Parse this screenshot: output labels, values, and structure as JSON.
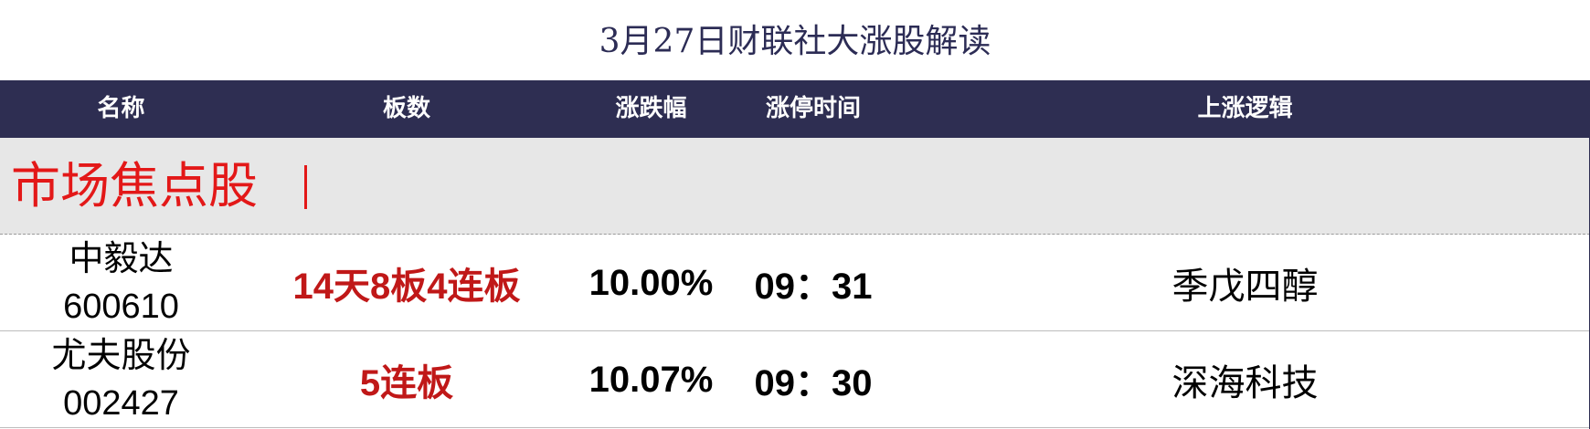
{
  "title": "3月27日财联社大涨股解读",
  "header": {
    "name": "名称",
    "boards": "板数",
    "change": "涨跌幅",
    "limit_time": "涨停时间",
    "logic": "上涨逻辑"
  },
  "section": {
    "label": "市场焦点股"
  },
  "rows": [
    {
      "name": "中毅达",
      "code": "600610",
      "boards": "14天8板4连板",
      "change": "10.00%",
      "limit_time": "09：31",
      "logic": "季戊四醇"
    },
    {
      "name": "尤夫股份",
      "code": "002427",
      "boards": "5连板",
      "change": "10.07%",
      "limit_time": "09：30",
      "logic": "深海科技"
    }
  ],
  "colors": {
    "header_bg": "#2e2e52",
    "section_bg": "#e7e7e7",
    "accent_red": "#e31818",
    "boards_red": "#c01818"
  }
}
